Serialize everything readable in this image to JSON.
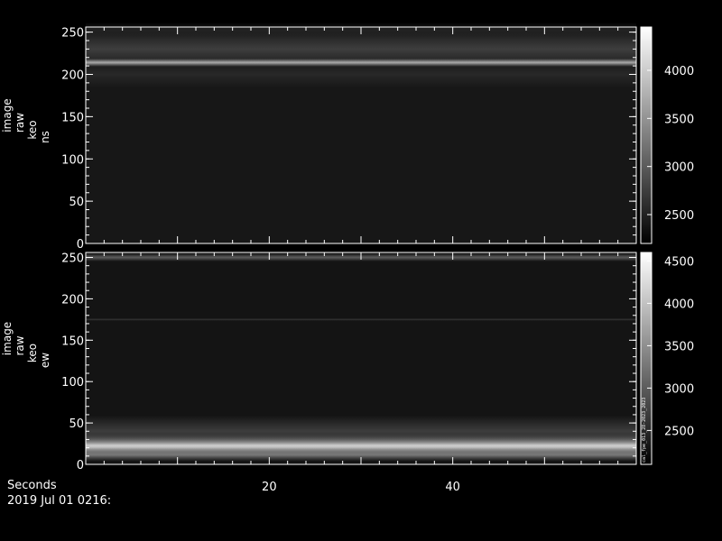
{
  "footer": {
    "x_axis_title": "Seconds",
    "timestamp": "2019 Jul 01 0216:"
  },
  "chart_data": [
    {
      "type": "heatmap",
      "ylabel_lines": [
        "image",
        "raw",
        "keo",
        "ns"
      ],
      "xlim": [
        0,
        60
      ],
      "ylim": [
        0,
        256
      ],
      "x_ticks": [
        20,
        40
      ],
      "y_ticks": [
        0,
        50,
        100,
        150,
        200,
        250
      ],
      "colorbar_range": [
        2200,
        4450
      ],
      "colorbar_ticks": [
        2500,
        3000,
        3500,
        4000
      ],
      "colormap": "grayscale",
      "background_level": 2400,
      "bands": [
        {
          "center": 214,
          "width": 3,
          "value": 4300
        },
        {
          "center": 230,
          "width": 14,
          "value": 2750
        },
        {
          "center": 200,
          "width": 10,
          "value": 2550
        },
        {
          "center": 252,
          "width": 6,
          "value": 2500
        }
      ],
      "note": ""
    },
    {
      "type": "heatmap",
      "ylabel_lines": [
        "image",
        "raw",
        "keo",
        "ew"
      ],
      "xlim": [
        0,
        60
      ],
      "ylim": [
        0,
        256
      ],
      "x_ticks": [
        20,
        40
      ],
      "y_ticks": [
        0,
        50,
        100,
        150,
        200,
        250
      ],
      "colorbar_range": [
        2100,
        4600
      ],
      "colorbar_ticks": [
        2500,
        3000,
        3500,
        4000,
        4500
      ],
      "colormap": "grayscale",
      "background_level": 2300,
      "bands": [
        {
          "center": 23,
          "width": 9,
          "value": 4300
        },
        {
          "center": 12,
          "width": 5,
          "value": 3300
        },
        {
          "center": 40,
          "width": 12,
          "value": 2700
        },
        {
          "center": 250,
          "width": 3,
          "value": 3000
        },
        {
          "center": 175,
          "width": 1,
          "value": 2600
        }
      ],
      "note": "cal_fpe_013_28-2023_2023"
    }
  ]
}
